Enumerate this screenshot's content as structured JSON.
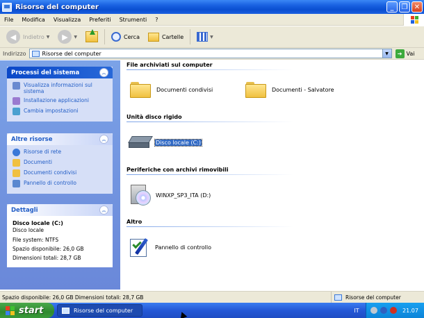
{
  "window": {
    "title": "Risorse del computer"
  },
  "menu": [
    "File",
    "Modifica",
    "Visualizza",
    "Preferiti",
    "Strumenti",
    "?"
  ],
  "toolbar": {
    "back": "Indietro",
    "search": "Cerca",
    "folders": "Cartelle"
  },
  "address": {
    "label": "Indirizzo",
    "value": "Risorse del computer",
    "go": "Vai"
  },
  "panels": {
    "system": {
      "title": "Processi del sistema",
      "tasks": [
        "Visualizza informazioni sul sistema",
        "Installazione applicazioni",
        "Cambia impostazioni"
      ]
    },
    "other": {
      "title": "Altre risorse",
      "tasks": [
        "Risorse di rete",
        "Documenti",
        "Documenti condivisi",
        "Pannello di controllo"
      ]
    },
    "details": {
      "title": "Dettagli",
      "name": "Disco locale (C:)",
      "lines": [
        "Disco locale",
        "File system: NTFS",
        "Spazio disponibile: 26,0 GB",
        "Dimensioni totali: 28,7 GB"
      ]
    }
  },
  "groups": {
    "stored": {
      "title": "File archiviati sul computer",
      "items": [
        "Documenti condivisi",
        "Documenti - Salvatore"
      ]
    },
    "drives": {
      "title": "Unità disco rigido",
      "items": [
        "Disco locale (C:)"
      ]
    },
    "removable": {
      "title": "Periferiche con archivi rimovibili",
      "items": [
        "WINXP_SP3_ITA (D:)"
      ]
    },
    "other": {
      "title": "Altro",
      "items": [
        "Pannello di controllo"
      ]
    }
  },
  "status": {
    "left": "Spazio disponibile: 26,0 GB Dimensioni totali: 28,7 GB",
    "right": "Risorse del computer"
  },
  "taskbar": {
    "start": "start",
    "window": "Risorse del computer",
    "lang": "IT",
    "clock": "21.07"
  }
}
